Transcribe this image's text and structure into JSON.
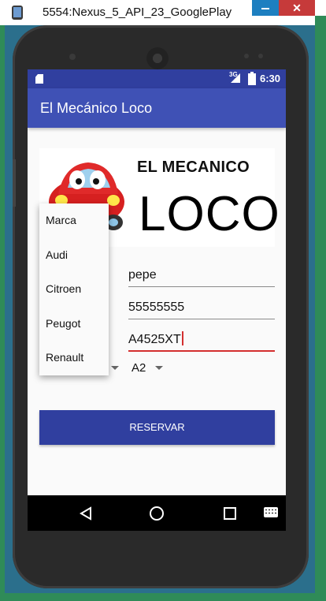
{
  "window": {
    "title": "5554:Nexus_5_API_23_GooglePlay",
    "close_label": "✕"
  },
  "status_bar": {
    "time": "6:30",
    "signal_label": "3G"
  },
  "app_bar": {
    "title": "El Mecánico Loco"
  },
  "banner": {
    "line1": "EL MECANICO",
    "line2": "LOCO"
  },
  "form": {
    "name_value": "pepe",
    "phone_value": "55555555",
    "plate_value": "A4525XT",
    "model_selected": "A2",
    "reserve_label": "RESERVAR"
  },
  "dropdown": {
    "items": [
      "Marca",
      "Audi",
      "Citroen",
      "Peugot",
      "Renault"
    ]
  },
  "colors": {
    "status_bar": "#303f9f",
    "app_bar": "#3f51b5",
    "button": "#303f9f",
    "active_underline": "#d32f2f"
  },
  "icons": {
    "nav": [
      "back-icon",
      "home-icon",
      "recents-icon",
      "keyboard-icon"
    ],
    "status": [
      "sd-card-icon",
      "signal-icon",
      "battery-icon"
    ]
  }
}
